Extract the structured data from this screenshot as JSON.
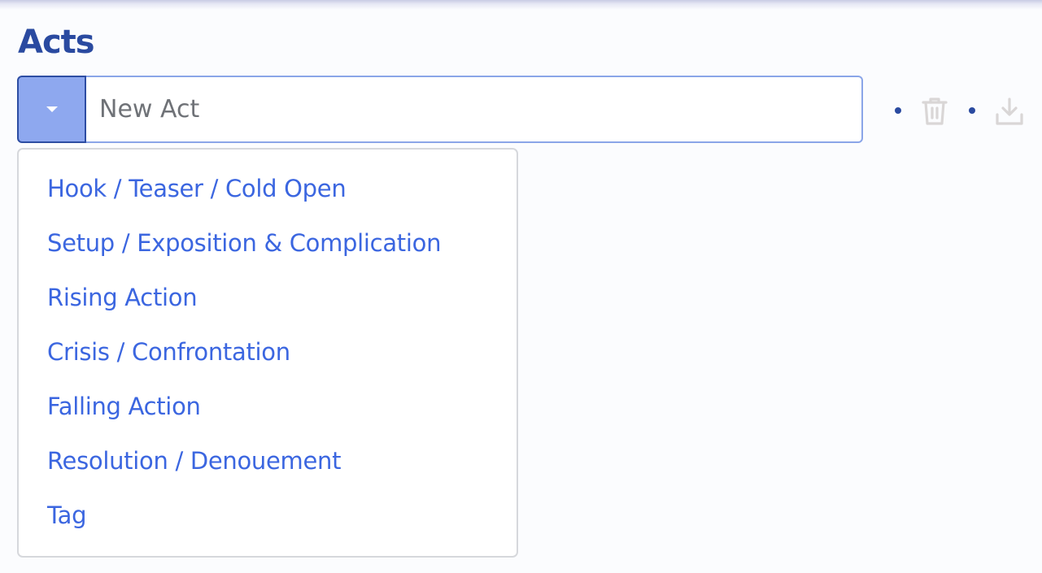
{
  "header": {
    "title": "Acts"
  },
  "act_selector": {
    "input_value": "",
    "placeholder": "New Act",
    "dropdown_icon": "caret-down-icon"
  },
  "toolbar": {
    "delete_icon": "trash-icon",
    "download_icon": "download-icon"
  },
  "colors": {
    "title": "#2a4aa0",
    "dropdown_button_bg": "#8ea8ef",
    "menu_item_text": "#3b66e0",
    "icon_disabled": "#d9d6d6"
  },
  "dropdown_menu": {
    "items": [
      {
        "label": "Hook / Teaser / Cold Open"
      },
      {
        "label": "Setup / Exposition & Complication"
      },
      {
        "label": "Rising Action"
      },
      {
        "label": "Crisis / Confrontation"
      },
      {
        "label": "Falling Action"
      },
      {
        "label": "Resolution / Denouement"
      },
      {
        "label": "Tag"
      }
    ]
  }
}
